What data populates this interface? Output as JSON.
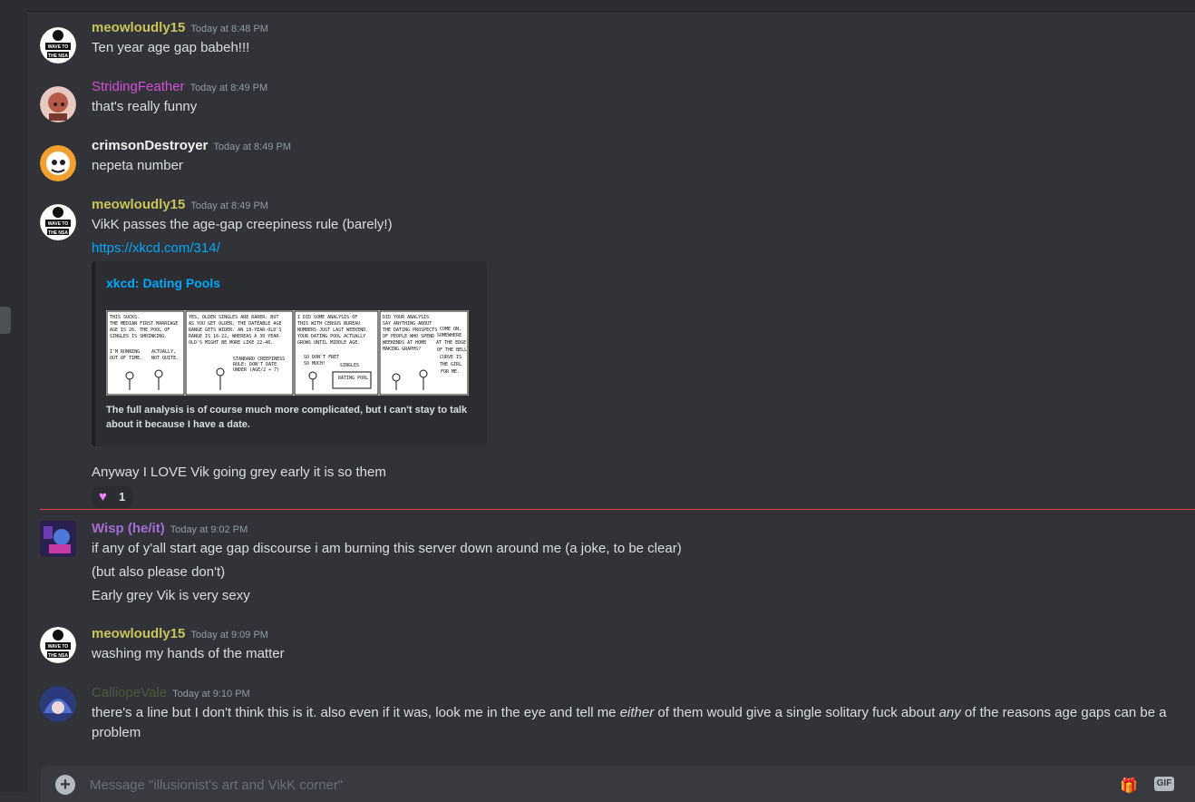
{
  "channel": {
    "composer_placeholder": "Message \"illusionist's art and VikK corner\"",
    "gif_label": "GIF"
  },
  "colors": {
    "meowloudly": "#c9c45a",
    "striding": "#d64fd6",
    "crimson": "#f2f3f5",
    "wisp": "#a66cd6",
    "calliope": "#4f5a3a",
    "link": "#00a8fc",
    "new_divider": "#f23f43"
  },
  "messages": [
    {
      "username": "meowloudly15",
      "timestamp": "Today at 8:48 PM",
      "lines": [
        "Ten year age gap babeh!!!"
      ]
    },
    {
      "username": "StridingFeather",
      "timestamp": "Today at 8:49 PM",
      "lines": [
        "that's really funny"
      ]
    },
    {
      "username": "crimsonDestroyer",
      "timestamp": "Today at 8:49 PM",
      "lines": [
        "nepeta number"
      ]
    },
    {
      "username": "meowloudly15",
      "timestamp": "Today at 8:49 PM",
      "lines": [
        "VikK passes the age-gap creepiness rule (barely!)",
        "https://xkcd.com/314/",
        "Anyway I LOVE Vik going grey early it is so them"
      ],
      "embed": {
        "title": "xkcd: Dating Pools",
        "description": "The full analysis is of course much more complicated, but I can't stay to talk about it because I have a date.",
        "comic_panels": [
          "THIS SUCKS. THE MEDIAN FIRST MARRIAGE AGE IS 26. THE POOL OF SINGLES IS SHRINKING. I'M RUNNING OUT OF TIME. ACTUALLY, NOT QUITE.",
          "YES, OLDER SINGLES ARE RARER. BUT AS YOU GET OLDER, THE DATEABLE AGE RANGE GETS WIDER. AN 18-YEAR-OLD'S RANGE IS 16-22, WHEREAS A 30 YEAR OLD'S MIGHT BE MORE LIKE 22-46. STANDARD CREEPINESS RULE: DON'T DATE UNDER (AGE/2 + 7)",
          "I DID SOME ANALYSIS OF THIS WITH CENSUS BUREAU NUMBERS JUST LAST WEEKEND. YOUR DATING POOL ACTUALLY GROWS UNTIL MIDDLE AGE. SO DON'T FRET SO MUCH! SINGLES DATING POOL",
          "DID YOUR ANALYSIS SAY ANYTHING ABOUT THE DATING PROSPECTS OF PEOPLE WHO SPEND WEEKENDS AT HOME MAKING GRAPHS? COME ON. SOMEWHERE AT THE EDGE OF THE BELL CURVE IS THE GIRL FOR ME."
        ]
      },
      "reaction": {
        "emoji": "heart-icon",
        "count": "1"
      }
    },
    {
      "username": "Wisp (he/it)",
      "timestamp": "Today at 9:02 PM",
      "lines": [
        "if any of y'all start age gap discourse i am burning this server down around me (a joke, to be clear)",
        "(but also please don't)",
        "Early grey Vik is very sexy"
      ]
    },
    {
      "username": "meowloudly15",
      "timestamp": "Today at 9:09 PM",
      "lines": [
        "washing my hands of the matter"
      ]
    },
    {
      "username": "CalliopeVale",
      "timestamp": "Today at 9:10 PM",
      "parts": [
        "there's a line but I don't think this is it. also even if it was, look me in the eye and tell me ",
        "either",
        " of them would give a single solitary fuck about ",
        "any",
        " of the reasons age gaps can be a problem"
      ]
    }
  ],
  "avatar_text": {
    "nsa": "WAVE TO THE NSA"
  }
}
